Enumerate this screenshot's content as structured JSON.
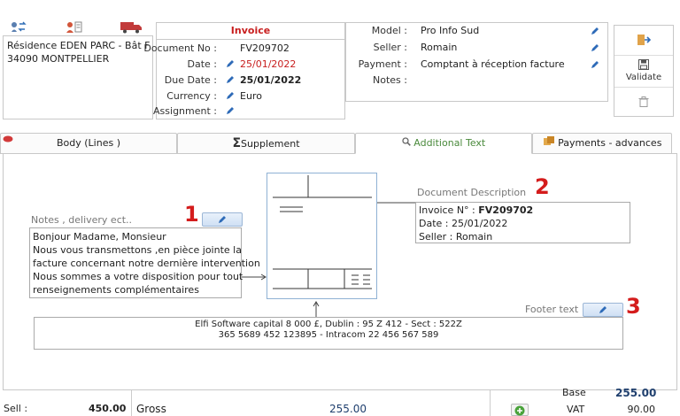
{
  "top_icons": [
    {
      "name": "exchange-icon"
    },
    {
      "name": "contact-card-icon"
    },
    {
      "name": "delivery-truck-icon"
    }
  ],
  "address": {
    "line1": "Résidence EDEN PARC -  Bât F",
    "line2": "34090 MONTPELLIER"
  },
  "invoice": {
    "title": "Invoice",
    "fields": [
      {
        "label": "Document No :",
        "value": "FV209702",
        "color": "#222222"
      },
      {
        "label": "Date :",
        "value": "25/01/2022",
        "color": "#c81e1e"
      },
      {
        "label": "Due Date :",
        "value": "25/01/2022",
        "color": "#222222"
      },
      {
        "label": "Currency :",
        "value": "Euro",
        "color": "#222222"
      },
      {
        "label": "Assignment :",
        "value": "",
        "color": "#222222"
      }
    ]
  },
  "details": {
    "fields": [
      {
        "label": "Model :",
        "value": "Pro Info Sud"
      },
      {
        "label": "Seller :",
        "value": "Romain"
      },
      {
        "label": "Payment :",
        "value": "Comptant à réception facture"
      },
      {
        "label": "Notes :",
        "value": ""
      }
    ]
  },
  "actions": {
    "validate_label": "Validate"
  },
  "tabs": [
    {
      "label": "Body (Lines )",
      "icon": "comment-icon"
    },
    {
      "label": "Supplement",
      "icon": "sigma-icon"
    },
    {
      "label": "Additional Text",
      "icon": "search-icon",
      "active": true
    },
    {
      "label": "Payments - advances",
      "icon": "coins-icon"
    }
  ],
  "notes": {
    "label": "Notes , delivery ect..",
    "lines": [
      "Bonjour  Madame, Monsieur",
      "Nous vous transmettons ,en pièce jointe la",
      "facture concernant notre dernière intervention",
      "Nous sommes a votre disposition pour tout",
      "renseignements complémentaires"
    ],
    "callout_number": "1"
  },
  "description": {
    "label": "Document Description",
    "invoice_prefix": "Invoice N° : ",
    "invoice_no": "FV209702",
    "date_line": "Date : 25/01/2022",
    "seller_line": "Seller : Romain",
    "callout_number": "2"
  },
  "footer": {
    "label": "Footer text",
    "line1": "Elfi Software capital 8 000 £, Dublin : 95 Z 412 - Sect : 522Z",
    "line2": "365 5689 452 123895 - Intracom  22 456 567 589",
    "callout_number": "3"
  },
  "totals": {
    "sell_label": "Sell :",
    "sell_value": "450.00",
    "gross_label": "Gross",
    "gross_value": "255.00",
    "base_label": "Base",
    "base_value": "255.00",
    "vat_label": "VAT",
    "vat_value": "90.00"
  },
  "colors": {
    "accent_red": "#c81e1e",
    "callout_red": "#d41c1c",
    "active_tab_green": "#4a8a3c",
    "edit_button_blue": "#cfe0f4",
    "base_value_blue": "#1f3f6e"
  }
}
